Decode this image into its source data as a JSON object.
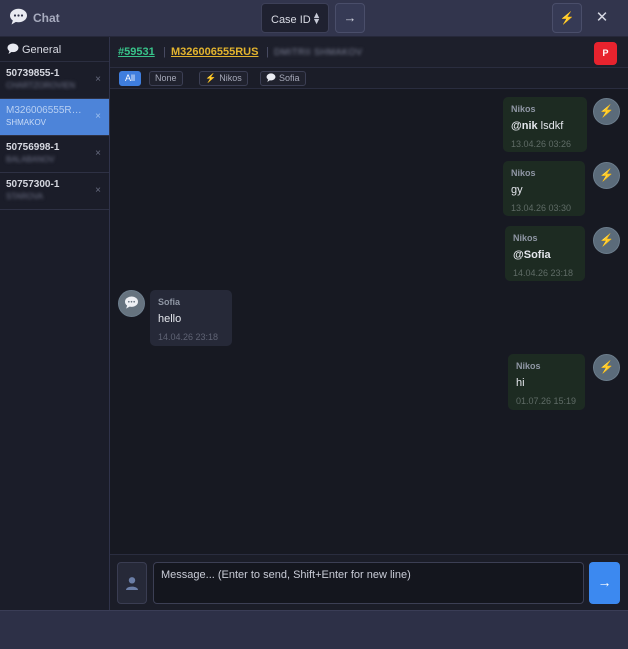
{
  "titlebar": {
    "title": "Chat",
    "case_select": "Case ID",
    "go_label": "→",
    "bolt_label": "⚡",
    "close_label": "✕"
  },
  "sidebar": {
    "general_label": "General",
    "items": [
      {
        "id": "50739855-1",
        "sub": "CHARTZOROVIEN",
        "close": "×"
      },
      {
        "id": "M326006555R…",
        "sub": "SHMAKOV",
        "close": "×"
      },
      {
        "id": "50756998-1",
        "sub": "BALABANOV",
        "close": "×"
      },
      {
        "id": "50757300-1",
        "sub": "STAROVA",
        "close": "×"
      }
    ]
  },
  "header": {
    "case_number": "#59531",
    "tracking": "M326006555RUS",
    "name": "DMITRII SHMAKOV",
    "separator": "|",
    "badge": "P"
  },
  "filters": {
    "all": "All",
    "none": "None",
    "nikos": "Nikos",
    "sofia": "Sofia"
  },
  "messages": [
    {
      "author": "Nikos",
      "mention": "@nik",
      "text": " lsdkf",
      "time": "13.04.26 03:26"
    },
    {
      "author": "Nikos",
      "mention": "",
      "text": "gy",
      "time": "13.04.26 03:30"
    },
    {
      "author": "Nikos",
      "mention": "@Sofia",
      "text": "",
      "time": "14.04.26 23:18"
    },
    {
      "author": "Sofia",
      "mention": "",
      "text": "hello",
      "time": "14.04.26 23:18"
    },
    {
      "author": "Nikos",
      "mention": "",
      "text": "hi",
      "time": "01.07.26 15:19"
    }
  ],
  "composer": {
    "placeholder": "Message... (Enter to send, Shift+Enter for new line)",
    "value": "",
    "send_label": "→"
  },
  "colors": {
    "accent": "#3f7ede",
    "case_number": "#38c38a",
    "tracking": "#e3b42e",
    "badge": "#e8232e"
  },
  "icons": {
    "title": "speech-bubble-icon",
    "bolt": "lightning-icon",
    "attach": "user-icon",
    "send": "arrow-right-icon"
  }
}
